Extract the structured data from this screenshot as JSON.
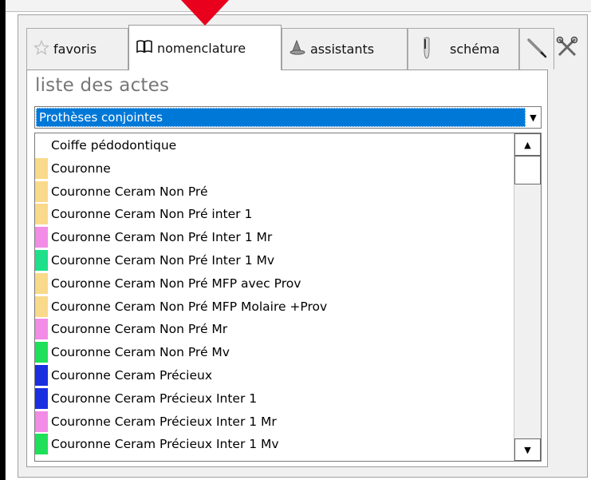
{
  "tabs": [
    {
      "label": "favoris",
      "icon": "star-icon"
    },
    {
      "label": "nomenclature",
      "icon": "open-book-icon"
    },
    {
      "label": "assistants",
      "icon": "wizard-hat-icon"
    },
    {
      "label": "schéma",
      "icon": "tooth-icon"
    },
    {
      "label": "",
      "icon": "pen-icon"
    },
    {
      "label": "",
      "icon": "tools-icon"
    }
  ],
  "active_tab": "nomenclature",
  "list_title": "liste des actes",
  "category_select": {
    "value": "Prothèses conjointes"
  },
  "acts": [
    {
      "label": "Coiffe pédodontique",
      "color": ""
    },
    {
      "label": "Couronne",
      "color": "#f9d98a"
    },
    {
      "label": "Couronne Ceram Non Pré",
      "color": "#f9d98a"
    },
    {
      "label": "Couronne Ceram Non Pré inter 1",
      "color": "#f9d98a"
    },
    {
      "label": "Couronne Ceram Non Pré Inter 1 Mr",
      "color": "#f28ce6"
    },
    {
      "label": "Couronne Ceram Non Pré Inter 1 Mv",
      "color": "#1ee08a"
    },
    {
      "label": "Couronne Ceram Non Pré MFP avec Prov",
      "color": "#f9d98a"
    },
    {
      "label": "Couronne Ceram Non Pré MFP Molaire +Prov",
      "color": "#f9d98a"
    },
    {
      "label": "Couronne Ceram Non Pré Mr",
      "color": "#f28ce6"
    },
    {
      "label": "Couronne Ceram Non Pré Mv",
      "color": "#1ee05a"
    },
    {
      "label": "Couronne Ceram Précieux",
      "color": "#1a2fe0"
    },
    {
      "label": "Couronne Ceram Précieux Inter 1",
      "color": "#1a2fe0"
    },
    {
      "label": "Couronne Ceram Précieux Inter 1 Mr",
      "color": "#f28ce6"
    },
    {
      "label": "Couronne Ceram Précieux Inter 1 Mv",
      "color": "#1ee05a"
    }
  ],
  "colors": {
    "selection": "#0078d7",
    "pointer": "#e8001c"
  }
}
